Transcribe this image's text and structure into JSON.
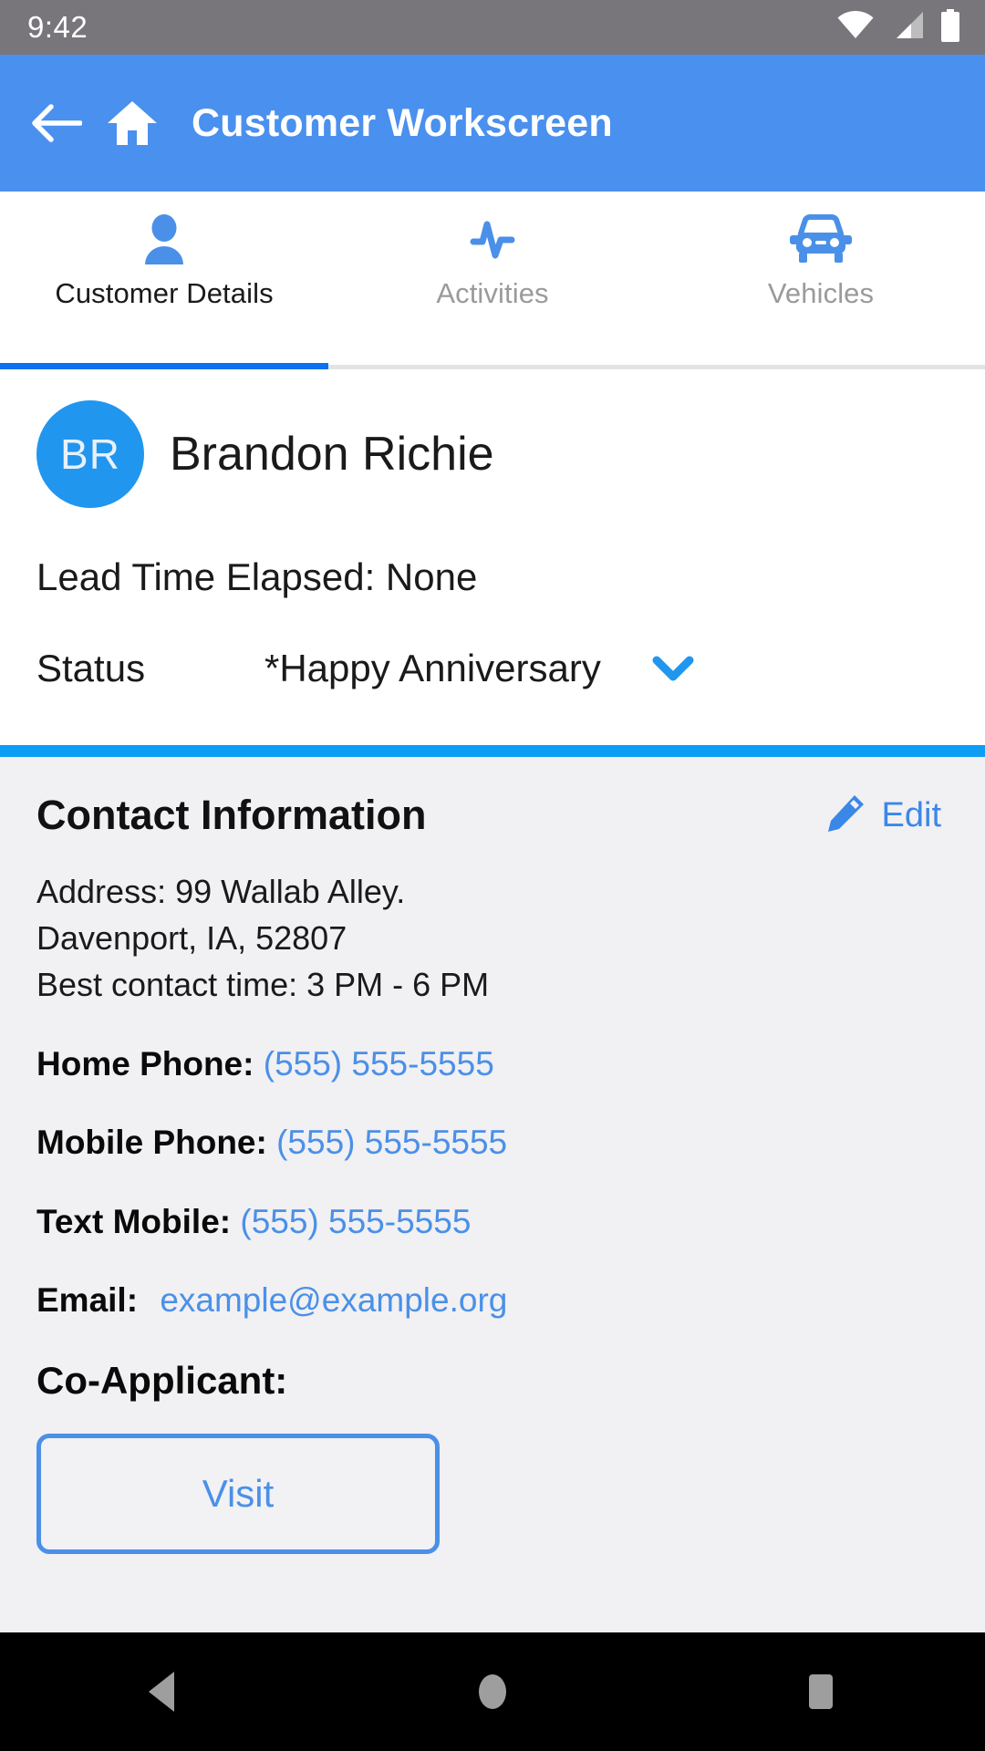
{
  "status_bar": {
    "time": "9:42",
    "icons": [
      "wifi-icon",
      "cell-signal-icon",
      "battery-icon"
    ]
  },
  "app_bar": {
    "back_icon": "back-arrow-icon",
    "home_icon": "home-icon",
    "title": "Customer Workscreen",
    "background_color": "#4A90EE"
  },
  "tabs": {
    "active_index": 0,
    "accent_color": "#0B71F0",
    "items": [
      {
        "label": "Customer Details",
        "icon": "person-icon"
      },
      {
        "label": "Activities",
        "icon": "activity-pulse-icon"
      },
      {
        "label": "Vehicles",
        "icon": "car-icon"
      }
    ]
  },
  "customer": {
    "avatar_initials": "BR",
    "avatar_color": "#2196EF",
    "name": "Brandon Richie",
    "lead_time": "Lead Time Elapsed: None",
    "status_label": "Status",
    "status_value": "*Happy Anniversary",
    "status_caret_icon": "chevron-down-icon"
  },
  "contact": {
    "title": "Contact Information",
    "edit_label": "Edit",
    "edit_icon": "pencil-icon",
    "address_lines": [
      "Address: 99 Wallab Alley.",
      "Davenport, IA, 52807",
      "Best contact time: 3 PM - 6 PM"
    ],
    "fields": [
      {
        "label": "Home Phone:",
        "value": "(555) 555-5555"
      },
      {
        "label": "Mobile Phone:",
        "value": "(555) 555-5555"
      },
      {
        "label": "Text Mobile:",
        "value": "(555) 555-5555"
      }
    ],
    "email_label": "Email:",
    "email_value": "example@example.org",
    "coapplicant_label": "Co-Applicant:",
    "visit_button": "Visit",
    "link_color": "#4A90E8"
  },
  "nav_bar": {
    "back_icon": "nav-back-triangle-icon",
    "home_icon": "nav-home-circle-icon",
    "recents_icon": "nav-recents-square-icon"
  }
}
